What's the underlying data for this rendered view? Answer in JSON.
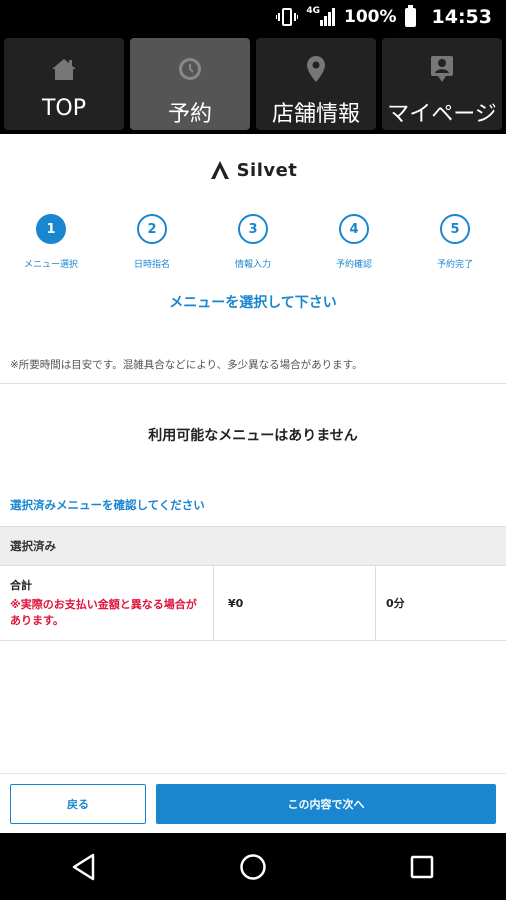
{
  "statusbar": {
    "network": "4G",
    "battery": "100%",
    "time": "14:53"
  },
  "nav": {
    "tabs": [
      {
        "label": "TOP",
        "icon": "home-icon"
      },
      {
        "label": "予約",
        "icon": "clock-icon"
      },
      {
        "label": "店舗情報",
        "icon": "location-pin-icon"
      },
      {
        "label": "マイページ",
        "icon": "profile-icon"
      }
    ],
    "active_index": 1
  },
  "logo": {
    "text": "Silvet"
  },
  "steps": [
    {
      "number": "1",
      "label": "メニュー選択"
    },
    {
      "number": "2",
      "label": "日時指名"
    },
    {
      "number": "3",
      "label": "情報入力"
    },
    {
      "number": "4",
      "label": "予約確認"
    },
    {
      "number": "5",
      "label": "予約完了"
    }
  ],
  "instruction": "メニューを選択して下さい",
  "note": "※所要時間は目安です。混雑具合などにより、多少異なる場合があります。",
  "empty_message": "利用可能なメニューはありません",
  "confirm_link": "選択済みメニューを確認してください",
  "selected": {
    "header": "選択済み",
    "total_label": "合計",
    "warning": "※実際のお支払い金額と異なる場合があります。",
    "price": "¥0",
    "duration": "0分"
  },
  "actions": {
    "back": "戻る",
    "next": "この内容で次へ"
  },
  "colors": {
    "accent": "#1a86d0",
    "warning": "#e0143c"
  }
}
